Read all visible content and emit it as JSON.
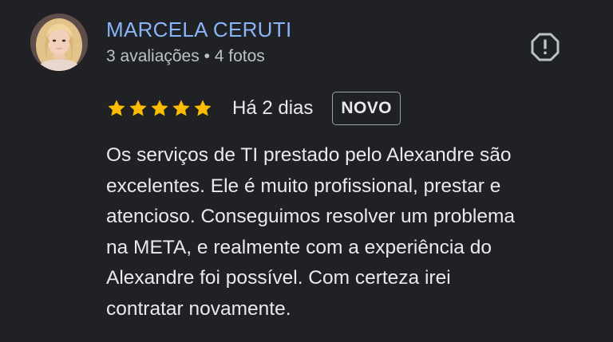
{
  "reviewer": {
    "name": "MARCELA CERUTI",
    "meta": "3 avaliações • 4 fotos",
    "avatar": "profile-photo"
  },
  "actions": {
    "report_icon": "alert-octagon-icon"
  },
  "rating": {
    "stars": 5,
    "max_stars": 5,
    "star_color": "#fbbc04",
    "date": "Há 2 dias",
    "badge": "NOVO"
  },
  "review": {
    "lines": [
      "Os serviços de TI prestado pelo Alexandre são",
      "excelentes. Ele é muito profissional, prestar e",
      "atencioso. Conseguimos resolver um problema",
      "na META, e realmente com a experiência do",
      "Alexandre foi possível. Com certeza irei",
      "contratar novamente."
    ]
  },
  "colors": {
    "background": "#202124",
    "name": "#8ab4f8",
    "text": "#e8eaed",
    "secondary_text": "#bdc1c6"
  }
}
